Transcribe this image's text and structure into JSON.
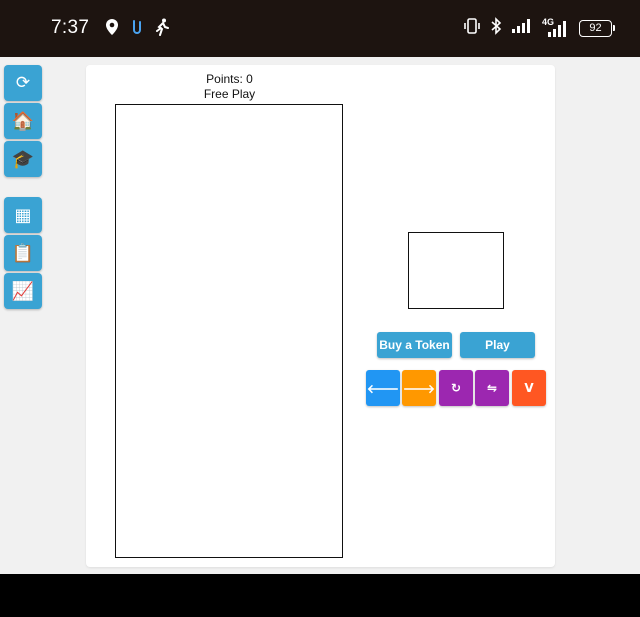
{
  "status_bar": {
    "time": "7:37",
    "network": "4G",
    "battery": "92",
    "left_icons": [
      "location-pin-icon",
      "clip-icon",
      "running-icon"
    ],
    "right_icons": [
      "vibrate-icon",
      "bluetooth-icon",
      "signal-icon",
      "signal-4g-icon",
      "battery-icon"
    ]
  },
  "sidebar": {
    "items": [
      {
        "name": "refresh",
        "glyph": "⟳"
      },
      {
        "name": "home",
        "glyph": "🏠"
      },
      {
        "name": "graduation-cap",
        "glyph": "🎓"
      },
      {
        "name": "grid",
        "glyph": "▦"
      },
      {
        "name": "clipboard",
        "glyph": "📋"
      },
      {
        "name": "chart",
        "glyph": "📈"
      }
    ]
  },
  "game": {
    "points_label": "Points: 0",
    "mode_label": "Free Play"
  },
  "buttons": {
    "buy_token": "Buy a Token",
    "play": "Play"
  },
  "controls": [
    {
      "name": "move-left",
      "glyph": "🡐",
      "color": "#2196f3"
    },
    {
      "name": "move-right",
      "glyph": "🡒",
      "color": "#ff9800"
    },
    {
      "name": "rotate",
      "glyph": "↻",
      "color": "#9c27b0"
    },
    {
      "name": "flip",
      "glyph": "⇋",
      "color": "#9c27b0"
    },
    {
      "name": "drop",
      "glyph": "V",
      "color": "#ff5722"
    }
  ],
  "colors": {
    "accent": "#3aa3d3",
    "status_bar": "#1d1410"
  }
}
